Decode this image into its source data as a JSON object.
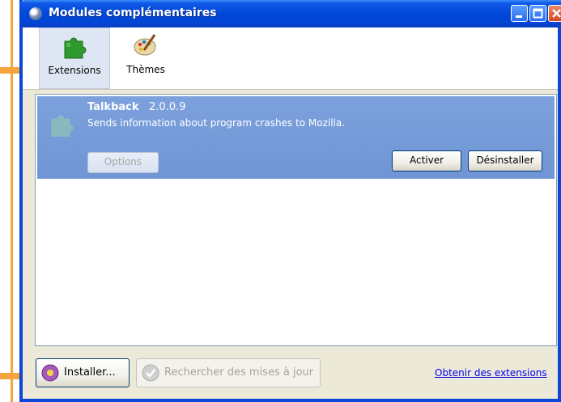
{
  "window": {
    "title": "Modules complémentaires",
    "controls": [
      "minimize",
      "maximize",
      "close"
    ]
  },
  "toolbar": {
    "tabs": [
      {
        "label": "Extensions",
        "icon": "puzzle-piece-icon",
        "selected": true
      },
      {
        "label": "Thèmes",
        "icon": "palette-brush-icon",
        "selected": false
      }
    ]
  },
  "extensions": [
    {
      "name": "Talkback",
      "version": "2.0.0.9",
      "description": "Sends information about program crashes to Mozilla.",
      "options_label": "Options",
      "enable_label": "Activer",
      "uninstall_label": "Désinstaller"
    }
  ],
  "footer": {
    "install_label": "Installer...",
    "find_updates_label": "Rechercher des mises à jour",
    "get_extensions_link": "Obtenir des extensions"
  },
  "colors": {
    "titlebar": "#0047d8",
    "selected_item": "#7499d9",
    "annotation_arrow": "#f5a33c"
  }
}
